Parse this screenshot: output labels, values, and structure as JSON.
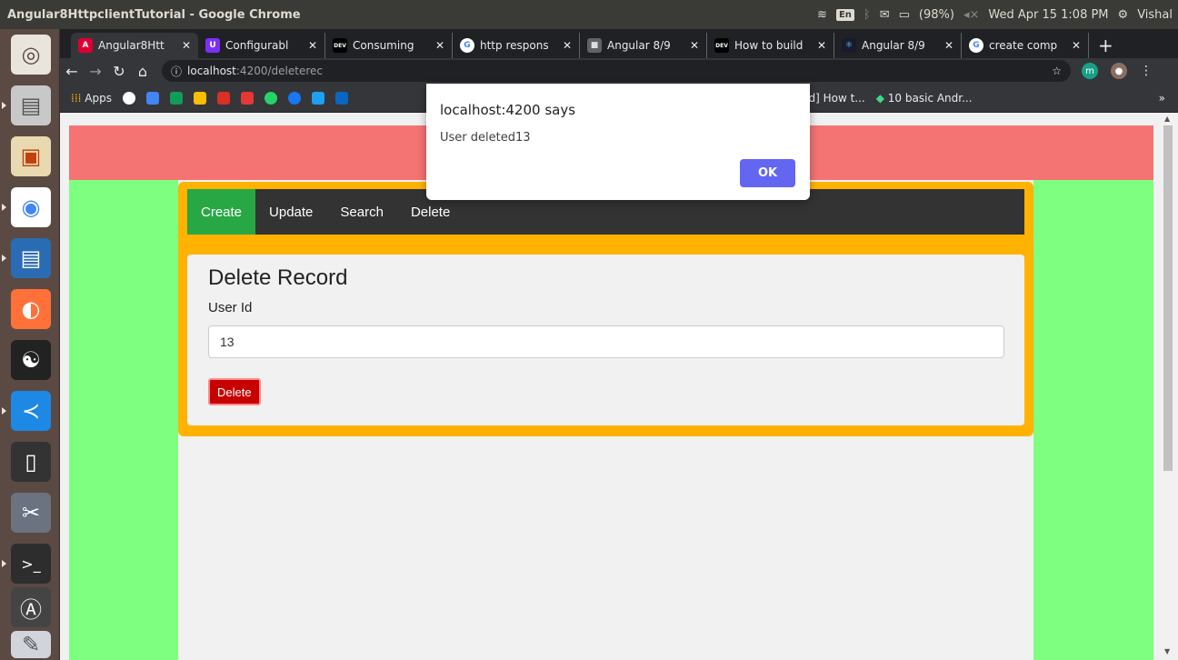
{
  "panel": {
    "window_title": "Angular8HttpclientTutorial - Google Chrome",
    "keyboard": "En",
    "battery": "(98%)",
    "clock": "Wed Apr 15  1:08 PM",
    "user": "Vishal"
  },
  "tabs": [
    {
      "label": "Angular8Htt",
      "favicon": "A",
      "color": "#dd0031",
      "active": true
    },
    {
      "label": "Configurabl",
      "favicon": "U",
      "color": "#7b2ff7",
      "active": false
    },
    {
      "label": "Consuming",
      "favicon": "DEV",
      "color": "#000000",
      "active": false
    },
    {
      "label": "http respons",
      "favicon": "G",
      "color": "#4285f4",
      "active": false
    },
    {
      "label": "Angular 8/9",
      "favicon": "■",
      "color": "#5f6368",
      "active": false
    },
    {
      "label": "How to build",
      "favicon": "DEV",
      "color": "#000000",
      "active": false
    },
    {
      "label": "Angular 8/9",
      "favicon": "⚛",
      "color": "#61dafb",
      "active": false
    },
    {
      "label": "create comp",
      "favicon": "G",
      "color": "#4285f4",
      "active": false
    }
  ],
  "toolbar": {
    "url_host": "localhost",
    "url_path": ":4200/deleterec",
    "info_icon": "ⓘ",
    "profile_initial": "m"
  },
  "bookmarks": {
    "apps_label": "Apps",
    "item_1": "ved] How t...",
    "item_2": "10 basic Andr...",
    "more": "»"
  },
  "page": {
    "nav": [
      {
        "label": "Create",
        "active": true
      },
      {
        "label": "Update",
        "active": false
      },
      {
        "label": "Search",
        "active": false
      },
      {
        "label": "Delete",
        "active": false
      }
    ],
    "form_title": "Delete Record",
    "field_label": "User Id",
    "field_value": "13",
    "delete_label": "Delete"
  },
  "alert": {
    "title": "localhost:4200 says",
    "message": "User deleted13",
    "ok_label": "OK"
  }
}
